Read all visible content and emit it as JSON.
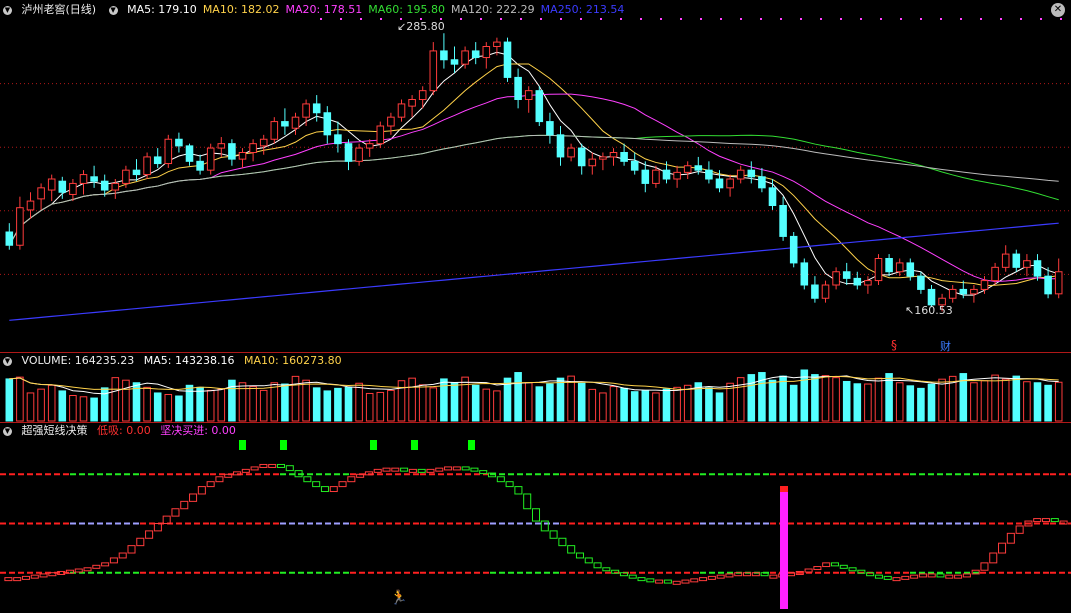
{
  "header": {
    "title": "泸州老窖(日线)",
    "ma": [
      {
        "label": "MA5: 179.10",
        "color": "#ffffff"
      },
      {
        "label": "MA10: 182.02",
        "color": "#ffd24a"
      },
      {
        "label": "MA20: 178.51",
        "color": "#ff40ff"
      },
      {
        "label": "MA60: 195.80",
        "color": "#33dd33"
      },
      {
        "label": "MA120: 222.29",
        "color": "#bbbbbb"
      },
      {
        "label": "MA250: 213.54",
        "color": "#3b3bff"
      }
    ]
  },
  "volume_header": {
    "label": "VOLUME: 164235.23",
    "ma5": "MA5: 143238.16",
    "ma10": "MA10: 160273.80"
  },
  "indicator_header": {
    "title": "超强短线决策",
    "low_buy": "低吸: 0.00",
    "strong_buy": "坚决买进: 0.00"
  },
  "annotations": {
    "high": "285.80",
    "low": "160.53",
    "marker_s": "§",
    "marker_cai": "财",
    "close_symbol": "✕"
  },
  "colors": {
    "up": "#ff3c3c",
    "down": "#54ffff",
    "ma5": "#ffffff",
    "ma10": "#ffd24a",
    "ma20": "#ff40ff",
    "ma60": "#33dd33",
    "ma120": "#bbbbbb",
    "ma250": "#3b3bff",
    "grid": "#b01818",
    "dash_red": "#ff2020",
    "dash_green": "#22ee22",
    "dash_purple": "#9f9fff",
    "signal": "#00ff00",
    "bar": "#ff22ff"
  },
  "chart_data": [
    {
      "type": "candlestick",
      "title": "泸州老窖(日线)",
      "y_range": [
        148,
        292
      ],
      "high_label": 285.8,
      "low_label": 160.53,
      "candles_ohlc": [
        [
          196,
          200,
          188,
          190
        ],
        [
          190,
          212,
          188,
          207
        ],
        [
          206,
          214,
          202,
          210
        ],
        [
          211,
          218,
          206,
          216
        ],
        [
          215,
          222,
          210,
          220
        ],
        [
          219,
          221,
          211,
          214
        ],
        [
          213,
          220,
          210,
          218
        ],
        [
          218,
          224,
          213,
          222
        ],
        [
          221,
          226,
          216,
          219
        ],
        [
          219,
          222,
          212,
          215
        ],
        [
          215,
          220,
          211,
          218
        ],
        [
          218,
          226,
          216,
          224
        ],
        [
          224,
          229,
          219,
          222
        ],
        [
          222,
          232,
          220,
          230
        ],
        [
          230,
          234,
          225,
          227
        ],
        [
          227,
          240,
          225,
          238
        ],
        [
          238,
          241,
          232,
          235
        ],
        [
          235,
          236,
          226,
          228
        ],
        [
          228,
          231,
          222,
          224
        ],
        [
          224,
          236,
          222,
          234
        ],
        [
          234,
          239,
          230,
          236
        ],
        [
          236,
          238,
          226,
          229
        ],
        [
          229,
          234,
          225,
          232
        ],
        [
          232,
          238,
          228,
          236
        ],
        [
          235,
          240,
          231,
          238
        ],
        [
          238,
          248,
          236,
          246
        ],
        [
          246,
          252,
          240,
          244
        ],
        [
          243,
          250,
          240,
          248
        ],
        [
          248,
          256,
          244,
          254
        ],
        [
          254,
          258,
          246,
          250
        ],
        [
          250,
          253,
          236,
          240
        ],
        [
          240,
          246,
          232,
          236
        ],
        [
          236,
          238,
          224,
          228
        ],
        [
          228,
          236,
          226,
          234
        ],
        [
          234,
          238,
          230,
          236
        ],
        [
          236,
          246,
          234,
          244
        ],
        [
          244,
          250,
          240,
          248
        ],
        [
          248,
          256,
          246,
          254
        ],
        [
          253,
          258,
          248,
          256
        ],
        [
          256,
          262,
          252,
          260
        ],
        [
          260,
          282,
          258,
          278
        ],
        [
          278,
          286,
          270,
          274
        ],
        [
          274,
          280,
          268,
          272
        ],
        [
          272,
          280,
          270,
          278
        ],
        [
          278,
          282,
          272,
          275
        ],
        [
          275,
          282,
          270,
          280
        ],
        [
          280,
          284,
          276,
          282
        ],
        [
          282,
          284,
          264,
          266
        ],
        [
          266,
          270,
          252,
          256
        ],
        [
          256,
          262,
          250,
          260
        ],
        [
          260,
          262,
          244,
          246
        ],
        [
          246,
          250,
          236,
          240
        ],
        [
          240,
          244,
          226,
          230
        ],
        [
          230,
          236,
          228,
          234
        ],
        [
          234,
          236,
          222,
          226
        ],
        [
          226,
          232,
          222,
          229
        ],
        [
          229,
          232,
          224,
          230
        ],
        [
          230,
          234,
          226,
          232
        ],
        [
          232,
          236,
          226,
          228
        ],
        [
          228,
          232,
          222,
          224
        ],
        [
          224,
          228,
          214,
          218
        ],
        [
          218,
          226,
          216,
          224
        ],
        [
          224,
          228,
          218,
          220
        ],
        [
          220,
          226,
          216,
          223
        ],
        [
          223,
          228,
          220,
          226
        ],
        [
          226,
          230,
          222,
          224
        ],
        [
          224,
          228,
          218,
          220
        ],
        [
          220,
          224,
          214,
          216
        ],
        [
          216,
          222,
          212,
          220
        ],
        [
          220,
          226,
          218,
          224
        ],
        [
          224,
          228,
          218,
          221
        ],
        [
          221,
          225,
          214,
          216
        ],
        [
          216,
          220,
          206,
          208
        ],
        [
          208,
          212,
          192,
          194
        ],
        [
          194,
          196,
          180,
          182
        ],
        [
          182,
          184,
          170,
          172
        ],
        [
          172,
          176,
          164,
          166
        ],
        [
          166,
          174,
          164,
          172
        ],
        [
          172,
          180,
          170,
          178
        ],
        [
          178,
          182,
          172,
          175
        ],
        [
          175,
          178,
          170,
          172
        ],
        [
          172,
          176,
          168,
          174
        ],
        [
          174,
          186,
          172,
          184
        ],
        [
          184,
          186,
          176,
          178
        ],
        [
          178,
          184,
          176,
          182
        ],
        [
          182,
          184,
          174,
          176
        ],
        [
          176,
          178,
          168,
          170
        ],
        [
          170,
          172,
          162,
          163
        ],
        [
          163,
          168,
          160,
          166
        ],
        [
          166,
          172,
          164,
          170
        ],
        [
          170,
          174,
          166,
          168
        ],
        [
          168,
          172,
          164,
          170
        ],
        [
          170,
          176,
          168,
          174
        ],
        [
          174,
          182,
          172,
          180
        ],
        [
          180,
          190,
          178,
          186
        ],
        [
          186,
          188,
          178,
          180
        ],
        [
          180,
          186,
          176,
          183
        ],
        [
          183,
          186,
          174,
          176
        ],
        [
          176,
          180,
          166,
          168
        ],
        [
          168,
          184,
          166,
          178
        ]
      ],
      "moving_averages": [
        "MA5",
        "MA10",
        "MA20",
        "MA60",
        "MA120",
        "MA250"
      ]
    },
    {
      "type": "bar",
      "title": "VOLUME",
      "y_range": [
        0,
        200000
      ],
      "values": [
        165,
        172,
        110,
        125,
        140,
        118,
        100,
        95,
        90,
        130,
        170,
        160,
        150,
        132,
        110,
        104,
        98,
        140,
        132,
        120,
        125,
        160,
        150,
        135,
        120,
        150,
        145,
        175,
        160,
        130,
        118,
        128,
        132,
        148,
        108,
        112,
        120,
        158,
        168,
        142,
        130,
        165,
        150,
        172,
        140,
        125,
        118,
        168,
        190,
        150,
        134,
        145,
        168,
        176,
        148,
        124,
        110,
        135,
        128,
        115,
        118,
        110,
        125,
        132,
        140,
        150,
        130,
        110,
        148,
        170,
        182,
        190,
        160,
        176,
        140,
        200,
        182,
        178,
        170,
        155,
        146,
        145,
        168,
        186,
        150,
        138,
        128,
        144,
        164,
        175,
        186,
        150,
        158,
        180,
        164,
        176,
        154,
        150,
        140,
        152
      ]
    },
    {
      "type": "line",
      "title": "超强短线决策",
      "y_range": [
        0,
        100
      ],
      "reference_levels": [
        90,
        50,
        10
      ],
      "values": [
        6,
        6,
        7,
        8,
        9,
        10,
        11,
        12,
        13,
        14,
        16,
        18,
        22,
        26,
        32,
        38,
        44,
        50,
        56,
        62,
        68,
        74,
        80,
        84,
        88,
        90,
        92,
        94,
        96,
        98,
        98,
        97,
        93,
        88,
        84,
        80,
        76,
        80,
        84,
        88,
        90,
        92,
        94,
        95,
        95,
        94,
        94,
        93,
        94,
        95,
        96,
        96,
        95,
        93,
        91,
        88,
        84,
        80,
        74,
        62,
        52,
        44,
        38,
        32,
        26,
        22,
        18,
        14,
        12,
        10,
        8,
        6,
        5,
        4,
        4,
        3,
        3,
        4,
        5,
        6,
        7,
        8,
        9,
        10,
        10,
        10,
        8,
        8,
        9,
        10,
        11,
        13,
        15,
        18,
        16,
        14,
        12,
        10,
        8,
        7,
        6,
        6,
        7,
        8,
        9,
        9,
        8,
        8,
        8,
        9,
        12,
        18,
        26,
        34,
        42,
        48,
        52,
        54,
        54,
        52,
        52
      ],
      "signals_x": [
        22,
        26,
        34,
        38,
        44
      ],
      "highlight_bar_index": 73
    }
  ]
}
